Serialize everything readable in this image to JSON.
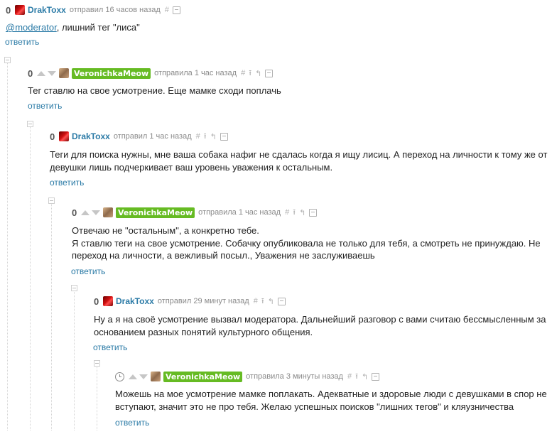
{
  "labels": {
    "reply": "ответить"
  },
  "comments": [
    {
      "rating": "0",
      "user": "DrakToxx",
      "meta": "отправил 16 часов назад",
      "lines": [
        "@moderator",
        ", лишний тег \"лиса\""
      ]
    },
    {
      "rating": "0",
      "user": "VeronichkaMeow",
      "meta": "отправила 1 час назад",
      "lines": [
        "Тег ставлю на свое усмотрение. Еще мамке сходи поплачь"
      ]
    },
    {
      "rating": "0",
      "user": "DrakToxx",
      "meta": "отправил 1 час назад",
      "lines": [
        "Теги для поиска нужны, мне ваша собака нафиг не сдалась когда я ищу лисиц. А переход на личности к тому же от",
        "девушки лишь подчеркивает ваш уровень уважения к остальным."
      ]
    },
    {
      "rating": "0",
      "user": "VeronichkaMeow",
      "meta": "отправила 1 час назад",
      "lines": [
        "Отвечаю не \"остальным\", а конкретно тебе.",
        "Я ставлю теги на свое усмотрение. Собачку опубликовала не только для тебя, а смотреть не принуждаю. Не",
        "переход на личности, а вежливый посыл., Уважения не заслуживаешь"
      ]
    },
    {
      "rating": "0",
      "user": "DrakToxx",
      "meta": "отправил 29 минут назад",
      "lines": [
        "Ну а я на своё усмотрение вызвал модератора. Дальнейший разговор с вами считаю бессмысленным за",
        "основанием разных понятий культурного общения."
      ]
    },
    {
      "user": "VeronichkaMeow",
      "meta": "отправила 3 минуты назад",
      "lines": [
        "Можешь на мое усмотрение мамке поплакать. Адекватные и здоровые люди с девушками в спор не",
        "вступают, значит это не про тебя. Желаю успешных поисков \"лишних тегов\" и кляузничества"
      ]
    }
  ],
  "tools": {
    "hash": "#",
    "upload": "⭱",
    "parent": "↰"
  },
  "colors": {
    "link": "#2a7aa6",
    "badge": "#66bb23",
    "meta": "#8a8a8a"
  }
}
